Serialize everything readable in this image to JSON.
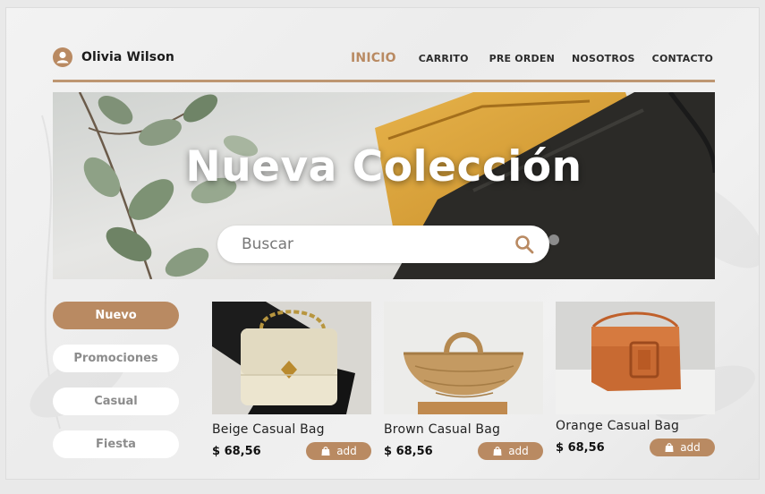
{
  "user": {
    "name": "Olivia Wilson"
  },
  "nav": [
    {
      "label": "INICIO",
      "active": true
    },
    {
      "label": "CARRITO"
    },
    {
      "label": "PRE ORDEN"
    },
    {
      "label": "NOSOTROS"
    },
    {
      "label": "CONTACTO"
    }
  ],
  "hero": {
    "title": "Nueva Colección",
    "search_placeholder": "Buscar"
  },
  "categories": [
    {
      "label": "Nuevo",
      "active": true
    },
    {
      "label": "Promociones"
    },
    {
      "label": "Casual"
    },
    {
      "label": "Fiesta"
    }
  ],
  "products": [
    {
      "name": "Beige Casual Bag",
      "price": "$ 68,56",
      "add_label": "add"
    },
    {
      "name": "Brown Casual Bag",
      "price": "$ 68,56",
      "add_label": "add"
    },
    {
      "name": "Orange Casual Bag",
      "price": "$ 68,56",
      "add_label": "add"
    }
  ],
  "colors": {
    "accent": "#b98a62",
    "divider": "#bd9671"
  }
}
